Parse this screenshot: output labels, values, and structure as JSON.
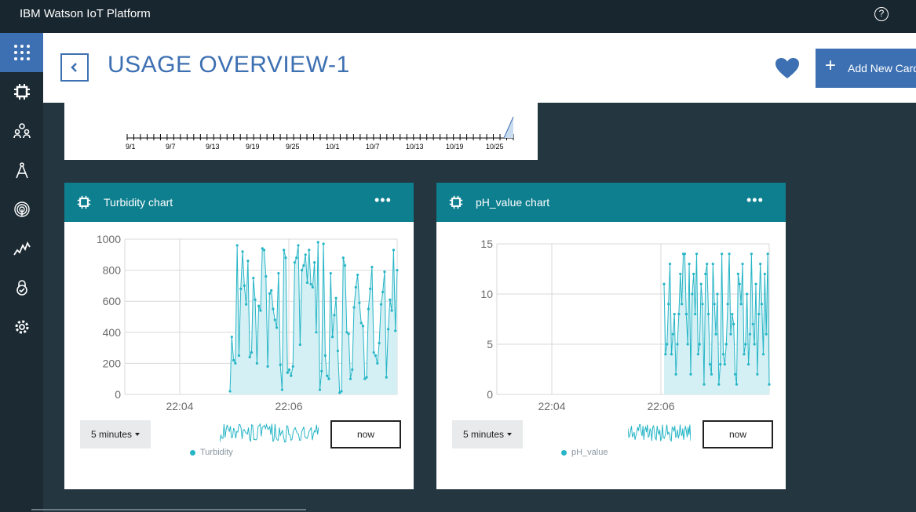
{
  "app": {
    "title": "IBM Watson IoT Platform"
  },
  "topbar": {
    "help_icon": "?"
  },
  "sidebar": {
    "items": [
      {
        "name": "apps-grid-icon",
        "active": true
      },
      {
        "name": "devices-icon"
      },
      {
        "name": "members-icon"
      },
      {
        "name": "rules-icon"
      },
      {
        "name": "security-fingerprint-icon"
      },
      {
        "name": "usage-chart-icon"
      },
      {
        "name": "lock-icon"
      },
      {
        "name": "settings-icon"
      }
    ]
  },
  "header": {
    "title": "USAGE OVERVIEW-1",
    "add_card_label": "Add New Card",
    "add_icon": "+"
  },
  "top_card": {
    "x_ticks": [
      "9/1",
      "9/7",
      "9/13",
      "9/19",
      "9/25",
      "10/1",
      "10/7",
      "10/13",
      "10/19",
      "10/25"
    ]
  },
  "cards": [
    {
      "title": "Turbidity chart",
      "more": "•••",
      "time_range": "5 minutes",
      "now_label": "now",
      "legend": "Turbidity",
      "chart_data": {
        "type": "area",
        "x_ticks": [
          "22:04",
          "22:06"
        ],
        "y_ticks": [
          "1000",
          "800",
          "600",
          "400",
          "200",
          "0"
        ],
        "ylim": [
          0,
          1000
        ],
        "series": [
          {
            "name": "Turbidity",
            "values": [
              20,
              370,
              220,
              200,
              960,
              250,
              680,
              920,
              700,
              580,
              860,
              240,
              270,
              750,
              610,
              200,
              570,
              540,
              940,
              930,
              760,
              180,
              650,
              670,
              550,
              480,
              430,
              780,
              190,
              30,
              930,
              880,
              140,
              160,
              120,
              180,
              850,
              880,
              960,
              320,
              800,
              830,
              900,
              720,
              930,
              710,
              690,
              850,
              400,
              980,
              30,
              150,
              970,
              250,
              120,
              100,
              780,
              370,
              510,
              620,
              280,
              10,
              20,
              880,
              830,
              400,
              390,
              100,
              160,
              560,
              690,
              770,
              590,
              460,
              440,
              100,
              110,
              550,
              680,
              820,
              270,
              250,
              200,
              330,
              580,
              660,
              790,
              110,
              420,
              610,
              540,
              930,
              410,
              800
            ]
          }
        ],
        "color": "#26b5c6"
      }
    },
    {
      "title": "pH_value chart",
      "more": "•••",
      "time_range": "5 minutes",
      "now_label": "now",
      "legend": "pH_value",
      "chart_data": {
        "type": "area",
        "x_ticks": [
          "22:04",
          "22:06"
        ],
        "y_ticks": [
          "15",
          "10",
          "5",
          "0"
        ],
        "ylim": [
          0,
          15
        ],
        "series": [
          {
            "name": "pH_value",
            "values": [
              11,
              4,
              5,
              9,
              13,
              4,
              6,
              8,
              2,
              5,
              8,
              12,
              9,
              14,
              14,
              8,
              5,
              13,
              2,
              10,
              12,
              8,
              14,
              4,
              5,
              11,
              9,
              1,
              12,
              13,
              8,
              3,
              2,
              13,
              9,
              6,
              10,
              1,
              3,
              14,
              4,
              3,
              5,
              9,
              14,
              6,
              8,
              7,
              2,
              1,
              12,
              11,
              9,
              13,
              4,
              5,
              10,
              3,
              6,
              14,
              7,
              5,
              11,
              2,
              8,
              13,
              9,
              4,
              12,
              6,
              14,
              1
            ]
          }
        ],
        "color": "#26b5c6"
      }
    }
  ],
  "colors": {
    "accent": "#3d70b2",
    "card_header": "#0e7f8f",
    "series": "#26b5c6",
    "background": "#243640"
  }
}
